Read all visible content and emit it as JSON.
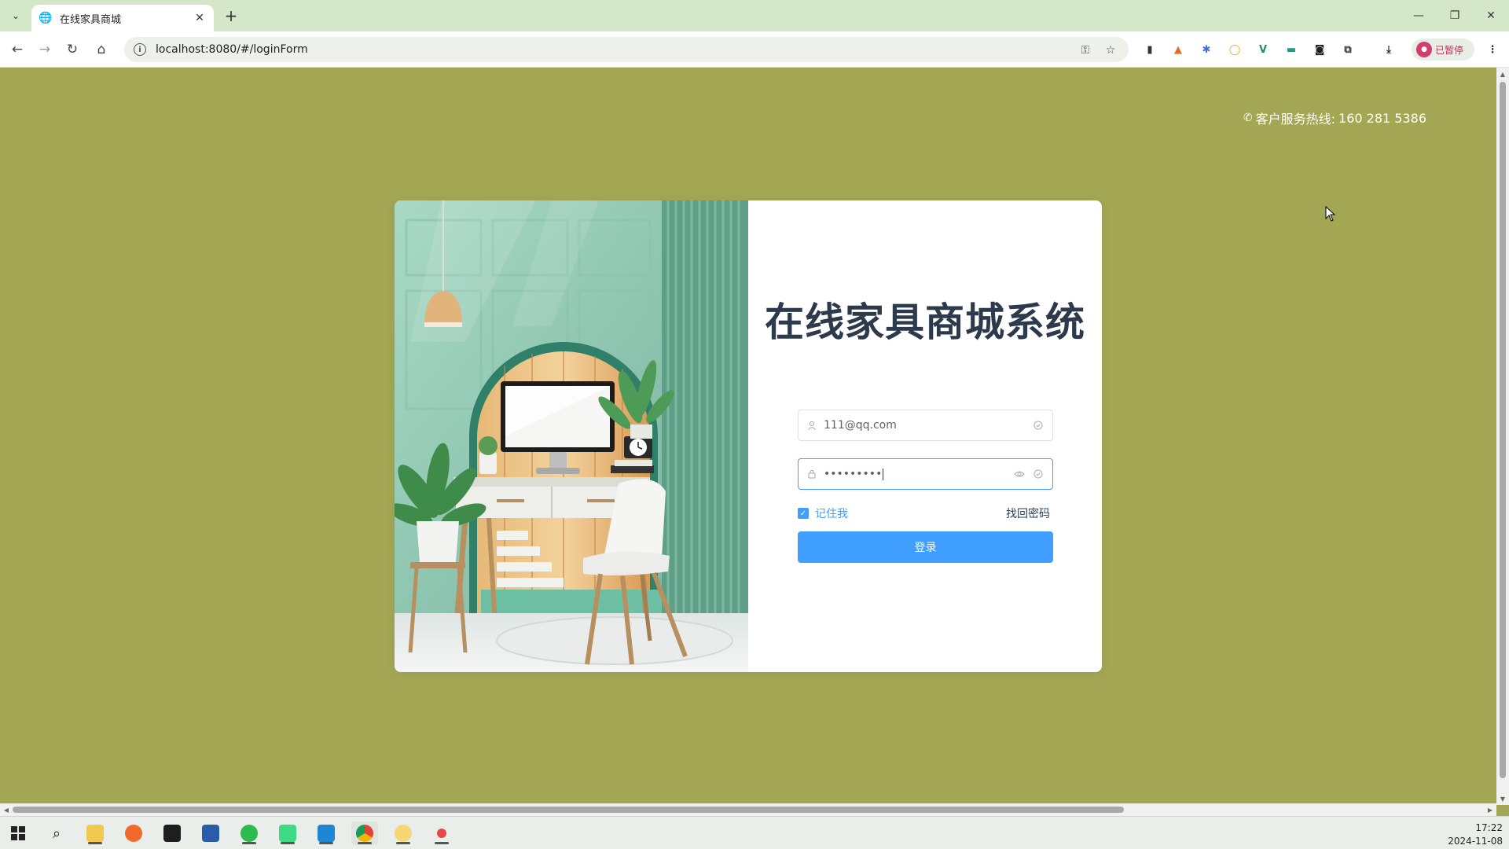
{
  "browser": {
    "tab_title": "在线家具商城",
    "url": "localhost:8080/#/loginForm",
    "profile_label": "已暂停"
  },
  "page": {
    "hotline_label": "客户服务热线:",
    "hotline_number": "160 281 5386",
    "title": "在线家具商城系统",
    "username_value": "111@qq.com",
    "password_masked": "•••••••••",
    "remember_label": "记住我",
    "forgot_label": "找回密码",
    "login_label": "登录",
    "colors": {
      "background": "#a3a754",
      "primary": "#409eff",
      "title": "#2d3a4b"
    }
  },
  "taskbar": {
    "time": "17:22",
    "date": "2024-11-08",
    "apps": [
      "start-icon",
      "search-icon",
      "file-explorer-icon",
      "firefox-icon",
      "terminal-icon",
      "powershell-icon",
      "wechat-icon",
      "android-studio-icon",
      "vscode-icon",
      "chrome-icon",
      "sticky-app-icon",
      "recorder-icon"
    ]
  }
}
